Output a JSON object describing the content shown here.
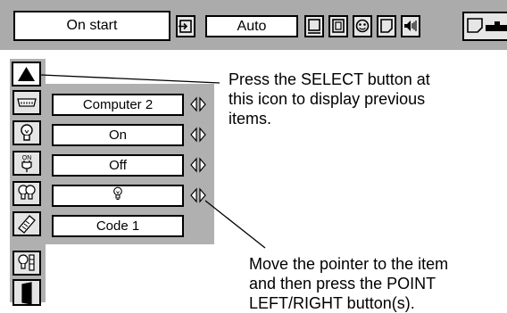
{
  "menu": {
    "title": "On start",
    "input_value": "Auto",
    "icons": [
      "input-icon",
      "screen-icon",
      "fullscreen-icon",
      "image-adjust-icon",
      "image-select-icon",
      "volume-icon",
      "setting-icon"
    ]
  },
  "side": {
    "up_icon": "up-triangle-icon",
    "items": [
      {
        "icon": "panel-icon",
        "value": "Computer 2",
        "has_arrows": true
      },
      {
        "icon": "lamp-icon",
        "value": "On",
        "has_arrows": true
      },
      {
        "icon": "power-on-icon",
        "value": "Off",
        "has_arrows": true
      },
      {
        "icon": "lamp-mode-icon",
        "value": "",
        "value_icon": "bulb-icon",
        "has_arrows": true
      },
      {
        "icon": "remote-control-icon",
        "value": "Code 1",
        "has_arrows": false
      },
      {
        "icon": "lamp-counter-icon"
      },
      {
        "icon": "door-icon"
      }
    ]
  },
  "callouts": {
    "select_info": "Press the SELECT button at\nthis icon to display previous\nitems.",
    "pointer_info": "Move the pointer to the item\nand then press the POINT\nLEFT/RIGHT button(s)."
  },
  "colors": {
    "panel_gray": "#b0b0b0",
    "bar_gray": "#ababab"
  }
}
